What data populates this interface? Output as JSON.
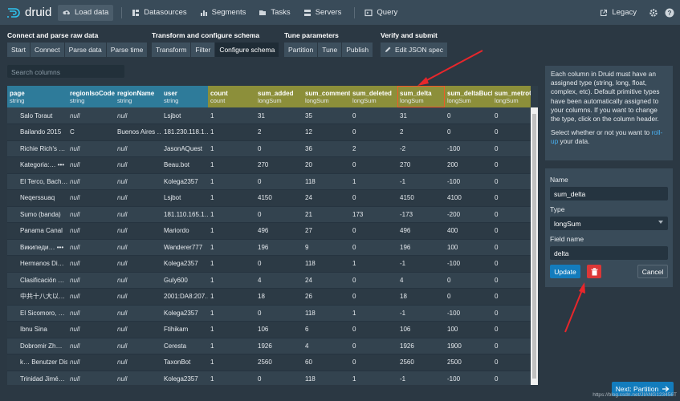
{
  "app": {
    "name": "druid"
  },
  "nav": {
    "items": [
      "Load data",
      "Datasources",
      "Segments",
      "Tasks",
      "Servers",
      "Query"
    ],
    "legacy": "Legacy"
  },
  "steps": [
    {
      "title": "Connect and parse raw data",
      "buttons": [
        "Start",
        "Connect",
        "Parse data",
        "Parse time"
      ]
    },
    {
      "title": "Transform and configure schema",
      "buttons": [
        "Transform",
        "Filter",
        "Configure schema"
      ]
    },
    {
      "title": "Tune parameters",
      "buttons": [
        "Partition",
        "Tune",
        "Publish"
      ]
    },
    {
      "title": "Verify and submit",
      "buttons": [
        "Edit JSON spec"
      ]
    }
  ],
  "search": {
    "placeholder": "Search columns"
  },
  "table": {
    "columns": [
      {
        "name": "page",
        "type": "string",
        "kind": "dim"
      },
      {
        "name": "regionIsoCode",
        "type": "string",
        "kind": "dim"
      },
      {
        "name": "regionName",
        "type": "string",
        "kind": "dim"
      },
      {
        "name": "user",
        "type": "string",
        "kind": "dim"
      },
      {
        "name": "count",
        "type": "count",
        "kind": "met"
      },
      {
        "name": "sum_added",
        "type": "longSum",
        "kind": "met"
      },
      {
        "name": "sum_comment",
        "type": "longSum",
        "kind": "met"
      },
      {
        "name": "sum_deleted",
        "type": "longSum",
        "kind": "met"
      },
      {
        "name": "sum_delta",
        "type": "longSum",
        "kind": "met",
        "selected": true
      },
      {
        "name": "sum_deltaBuck",
        "type": "longSum",
        "kind": "met"
      },
      {
        "name": "sum_metroCod",
        "type": "longSum",
        "kind": "met"
      }
    ],
    "rows": [
      [
        "Salo Toraut",
        "null",
        "null",
        "Lsjbot",
        "1",
        "31",
        "35",
        "0",
        "31",
        "0",
        "0"
      ],
      [
        "Bailando 2015",
        "C",
        "Buenos Aires …",
        "181.230.118.1…",
        "1",
        "2",
        "12",
        "0",
        "2",
        "0",
        "0"
      ],
      [
        "Richie Rich's …",
        "null",
        "null",
        "JasonAQuest",
        "1",
        "0",
        "36",
        "2",
        "-2",
        "-100",
        "0"
      ],
      [
        "Kategoria:…  •••",
        "null",
        "null",
        "Beau.bot",
        "1",
        "270",
        "20",
        "0",
        "270",
        "200",
        "0"
      ],
      [
        "El Terco, Bach…",
        "null",
        "null",
        "Kolega2357",
        "1",
        "0",
        "118",
        "1",
        "-1",
        "-100",
        "0"
      ],
      [
        "Neqerssuaq",
        "null",
        "null",
        "Lsjbot",
        "1",
        "4150",
        "24",
        "0",
        "4150",
        "4100",
        "0"
      ],
      [
        "Sumo (banda)",
        "null",
        "null",
        "181.110.165.1…",
        "1",
        "0",
        "21",
        "173",
        "-173",
        "-200",
        "0"
      ],
      [
        "Panama Canal",
        "null",
        "null",
        "Mariordo",
        "1",
        "496",
        "27",
        "0",
        "496",
        "400",
        "0"
      ],
      [
        "Википеди…  •••",
        "null",
        "null",
        "Wanderer777",
        "1",
        "196",
        "9",
        "0",
        "196",
        "100",
        "0"
      ],
      [
        "Hermanos Di…",
        "null",
        "null",
        "Kolega2357",
        "1",
        "0",
        "118",
        "1",
        "-1",
        "-100",
        "0"
      ],
      [
        "Clasificación …",
        "null",
        "null",
        "Guly600",
        "1",
        "4",
        "24",
        "0",
        "4",
        "0",
        "0"
      ],
      [
        "中共十八大以…",
        "null",
        "null",
        "2001:DA8:207…",
        "1",
        "18",
        "26",
        "0",
        "18",
        "0",
        "0"
      ],
      [
        "El Sicomoro, …",
        "null",
        "null",
        "Kolega2357",
        "1",
        "0",
        "118",
        "1",
        "-1",
        "-100",
        "0"
      ],
      [
        "Ibnu Sina",
        "null",
        "null",
        "Ftihikam",
        "1",
        "106",
        "6",
        "0",
        "106",
        "100",
        "0"
      ],
      [
        "Dobromir Zh…",
        "null",
        "null",
        "Ceresta",
        "1",
        "1926",
        "4",
        "0",
        "1926",
        "1900",
        "0"
      ],
      [
        "k…  Benutzer Disk…",
        "null",
        "null",
        "TaxonBot",
        "1",
        "2560",
        "60",
        "0",
        "2560",
        "2500",
        "0"
      ],
      [
        "Trinidad Jimé…",
        "null",
        "null",
        "Kolega2357",
        "1",
        "0",
        "118",
        "1",
        "-1",
        "-100",
        "0"
      ]
    ]
  },
  "sidebar": {
    "info_pre": "Each column in Druid must have an assigned type (string, long, float, complex, etc). Default primitive types have been automatically assigned to your columns. If you want to change the type, click on the column header.",
    "info_select": "Select whether or not you want to ",
    "info_link": "roll-up",
    "info_post": " your data.",
    "form": {
      "name_label": "Name",
      "name_value": "sum_delta",
      "type_label": "Type",
      "type_value": "longSum",
      "field_label": "Field name",
      "field_value": "delta",
      "update": "Update",
      "cancel": "Cancel"
    }
  },
  "footer": {
    "next": "Next: Partition",
    "watermark": "https://blog.csdn.net/JIANG123456T"
  },
  "colors": {
    "dim_header": "#2e7b9a",
    "met_header": "#8c8f3a",
    "accent": "#137cbd",
    "danger": "#db3737",
    "arrow": "#e8262b"
  }
}
